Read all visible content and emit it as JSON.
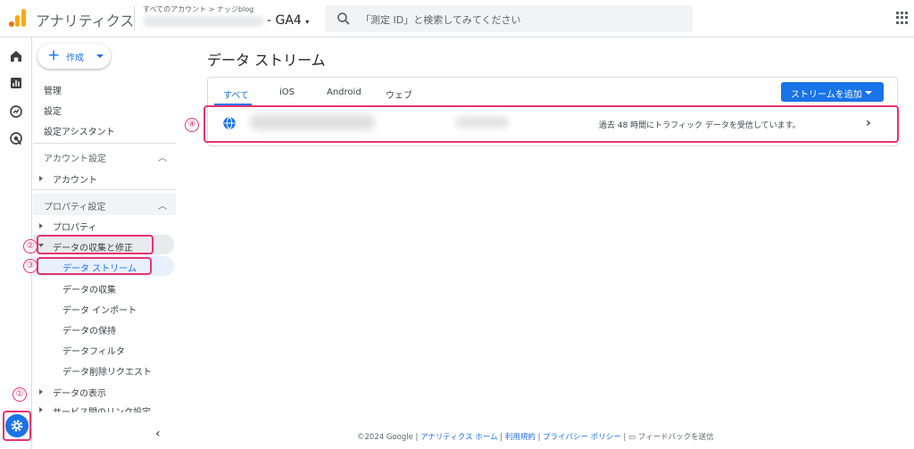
{
  "header": {
    "app_title": "アナリティクス",
    "breadcrumb": "すべてのアカウント > ナッジblog",
    "property_name": "- GA4",
    "search_placeholder": "「測定 ID」と検索してみてください"
  },
  "sidebar": {
    "create_label": "作成",
    "items_top": [
      "管理",
      "設定",
      "設定アシスタント"
    ],
    "account_section": {
      "title": "アカウント設定",
      "items": [
        "アカウント"
      ]
    },
    "property_section": {
      "title": "プロパティ設定",
      "property": "プロパティ",
      "data_collection": "データの収集と修正",
      "sub_items": [
        "データ ストリーム",
        "データの収集",
        "データ インポート",
        "データの保持",
        "データフィルタ",
        "データ削除リクエスト"
      ],
      "data_display": "データの表示",
      "service_links": "サービス間のリンク設定"
    }
  },
  "annotations": [
    "①",
    "②",
    "③",
    "④"
  ],
  "main": {
    "page_title": "データ ストリーム",
    "tabs": [
      "すべて",
      "iOS",
      "Android",
      "ウェブ"
    ],
    "add_stream_label": "ストリームを追加",
    "stream_status": "過去 48 時間にトラフィック データを受信しています。"
  },
  "footer": {
    "copyright": "©2024 Google | ",
    "analytics_home": "アナリティクス ホーム",
    "sep1": " | ",
    "terms": "利用規約",
    "sep2": " | ",
    "privacy": "プライバシー ポリシー",
    "sep3": " | ",
    "feedback": "フィードバックを送信"
  },
  "colors": {
    "accent": "#1a73e8",
    "annotation": "#e8336f"
  }
}
